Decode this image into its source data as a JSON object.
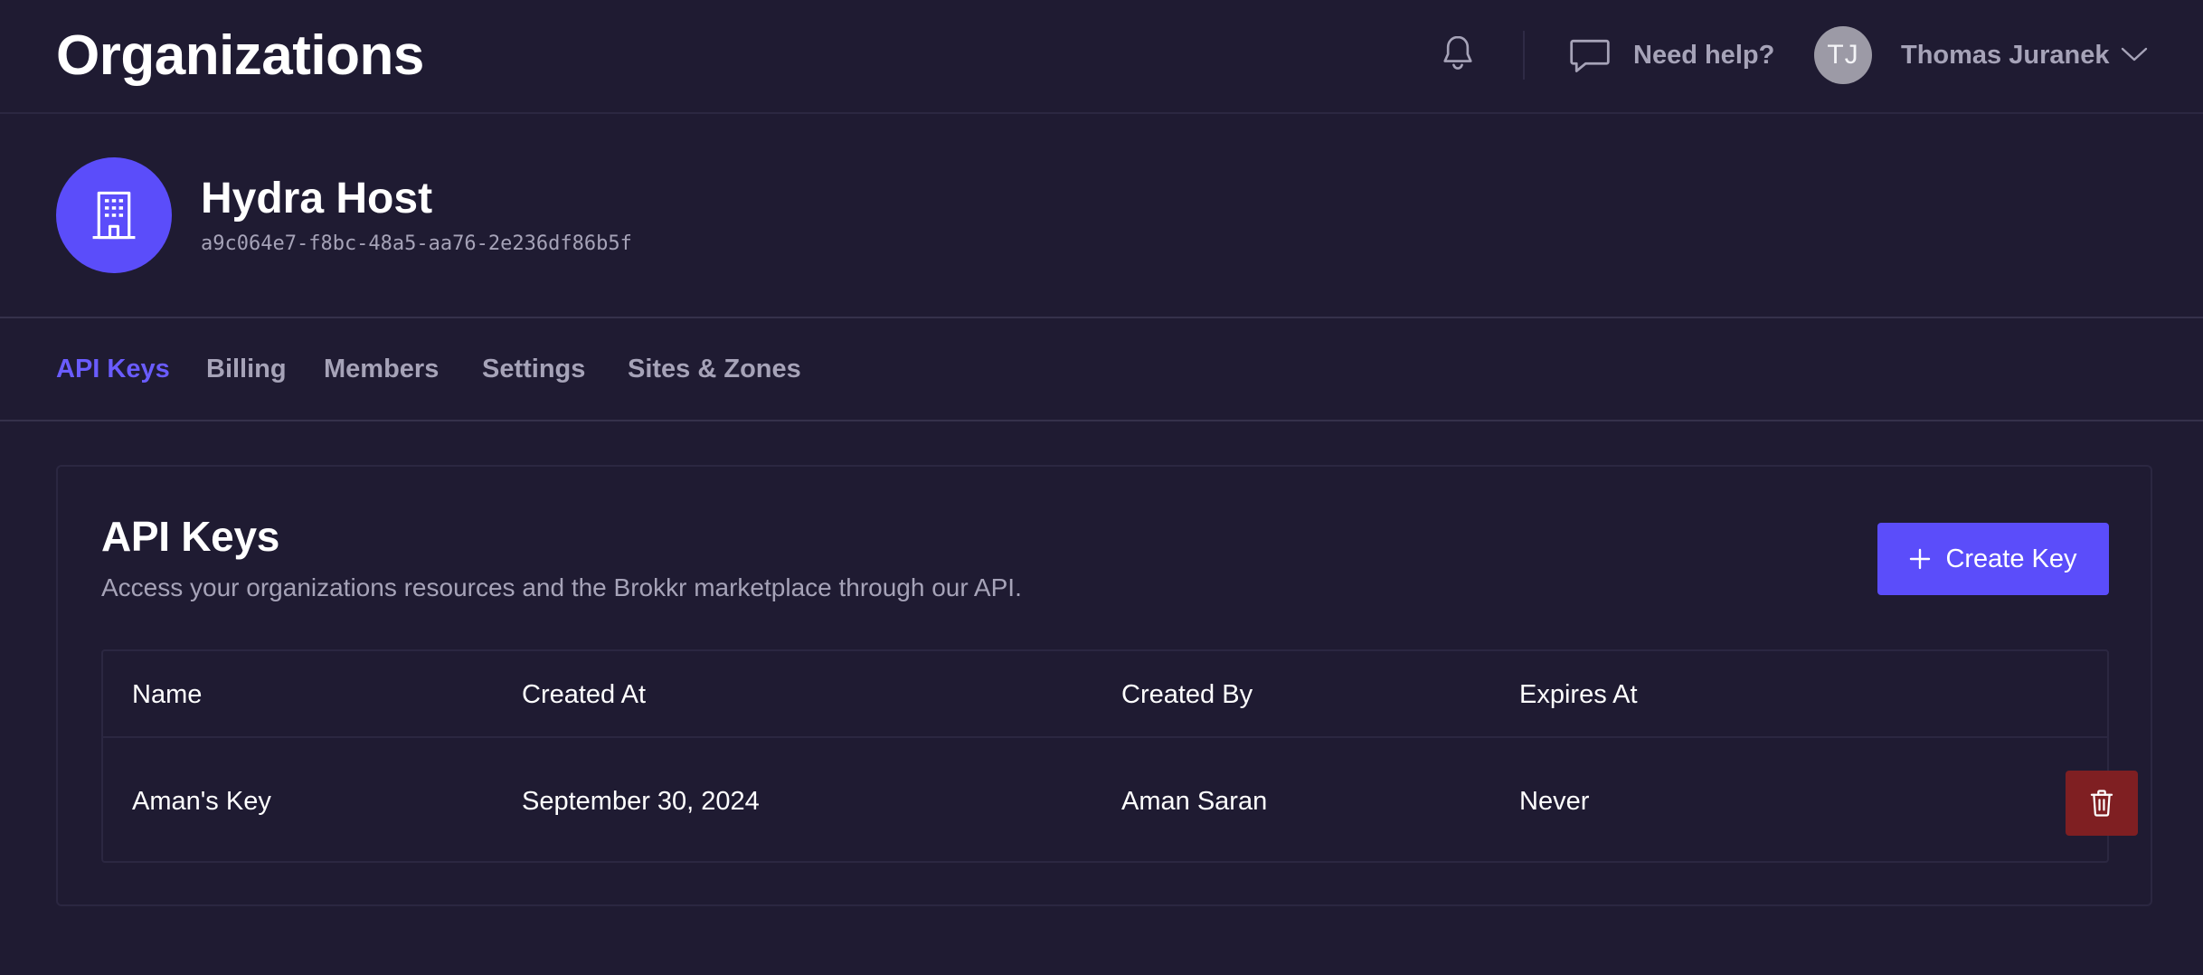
{
  "header": {
    "title": "Organizations",
    "notifications_icon": "bell-icon",
    "help_icon": "chat-bubble-icon",
    "help_label": "Need help?",
    "user": {
      "initials": "TJ",
      "name": "Thomas Juranek",
      "menu_icon": "chevron-down-icon"
    }
  },
  "organization": {
    "icon": "office-building-icon",
    "name": "Hydra Host",
    "id": "a9c064e7-f8bc-48a5-aa76-2e236df86b5f"
  },
  "tabs": [
    {
      "label": "API Keys",
      "active": true
    },
    {
      "label": "Billing",
      "active": false
    },
    {
      "label": "Members",
      "active": false
    },
    {
      "label": "Settings",
      "active": false
    },
    {
      "label": "Sites & Zones",
      "active": false
    }
  ],
  "api_keys": {
    "title": "API Keys",
    "description": "Access your organizations resources and the Brokkr marketplace through our API.",
    "create_button": {
      "icon": "plus-icon",
      "label": "Create Key"
    },
    "table": {
      "columns": [
        "Name",
        "Created At",
        "Created By",
        "Expires At"
      ],
      "rows": [
        {
          "name": "Aman's Key",
          "created_at": "September 30, 2024",
          "created_by": "Aman Saran",
          "expires_at": "Never",
          "delete_icon": "trash-icon"
        }
      ]
    }
  },
  "colors": {
    "background": "#1f1b32",
    "accent": "#5b4dfa",
    "active_tab": "#6a5cff",
    "muted_text": "#a6a3b8",
    "danger": "#7f1f22"
  }
}
